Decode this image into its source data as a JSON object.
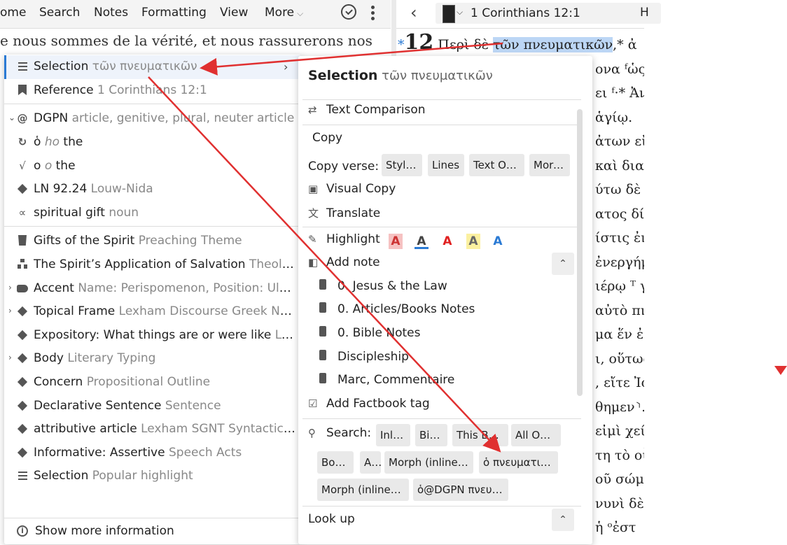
{
  "toolbar": {
    "items": [
      "ome",
      "Search",
      "Notes",
      "Formatting",
      "View",
      "More"
    ]
  },
  "right_pane": {
    "reference": "1 Corinthians 12:1",
    "header_cut": "H",
    "lines": [
      {
        "pre": "",
        "num": "12",
        "text": " Περὶ δὲ ",
        "hl": "τῶν πνευματικῶν",
        "post": ",* ἀ"
      },
      {
        "text": "ονα ᶠὡς ε"
      },
      {
        "text": "ει ᶠ·* Ἀν"
      },
      {
        "text": "ἁγίῳ."
      },
      {
        "text": "ἀτων εἰσ"
      },
      {
        "text": "καὶ διαι"
      },
      {
        "text": "ύτω δὲ δί"
      },
      {
        "text": "ατος δίδο"
      },
      {
        "text": "ίστις ἐν"
      },
      {
        "text": "ἐνεργήμ"
      },
      {
        "text": "ιέρῳ ᵀ γέ"
      },
      {
        "text": "αὐτὸ πνε"
      },
      {
        "text": "μα ἕν ἐσ"
      },
      {
        "text": "ι, οὕτως"
      },
      {
        "text": ", εἴτε Ἰο"
      },
      {
        "text": "θημεν⸃."
      },
      {
        "text": "εἰμὶ χείρ"
      },
      {
        "text": "τη τὸ οὖ"
      },
      {
        "text": "οῦ σώματ"
      },
      {
        "text": "νυνὶ δὲ ὁ"
      },
      {
        "text": "ἡ ᵒἐστ"
      }
    ]
  },
  "background_text": "e nous sommes de la vérité, et nous rassurerons nos",
  "left_menu": {
    "items": [
      {
        "icon": "lines",
        "label": "Selection",
        "sub": " τῶν πνευματικῶν",
        "expand": ""
      },
      {
        "icon": "bookmark",
        "label": "Reference",
        "sub": " 1 Corinthians 12:1",
        "expand": ""
      },
      {
        "icon": "at",
        "label": "DGPN",
        "sub": " article, genitive, plural, neuter article",
        "expand": "⌄"
      },
      {
        "icon": "circle",
        "label": "ὁ ",
        "sub_it": "ho",
        "label2": " the",
        "expand": ""
      },
      {
        "icon": "root",
        "label": "ο ",
        "sub_it": "o",
        "label2": " the",
        "expand": ""
      },
      {
        "icon": "diamond",
        "label": "LN 92.24",
        "sub": " Louw-Nida",
        "expand": ""
      },
      {
        "icon": "alpha",
        "label": "spiritual gift",
        "sub": " noun",
        "expand": ""
      },
      {
        "icon": "trash",
        "label": "Gifts of the Spirit",
        "sub": " Preaching Theme",
        "expand": ""
      },
      {
        "icon": "org",
        "label": "The Spirit’s Application of Salvation",
        "sub": " Theolo…",
        "expand": ""
      },
      {
        "icon": "tag",
        "label": "Accent",
        "sub": " Name: Perispomenon, Position: Ulti…",
        "expand": "›"
      },
      {
        "icon": "diamond",
        "label": "Topical Frame",
        "sub": " Lexham Discourse Greek New…",
        "expand": "›"
      },
      {
        "icon": "diamond",
        "label": "Expository: What things are or were like",
        "sub": " Lon…",
        "expand": ""
      },
      {
        "icon": "diamond",
        "label": "Body",
        "sub": " Literary Typing",
        "expand": "›"
      },
      {
        "icon": "diamond",
        "label": "Concern",
        "sub": " Propositional Outline",
        "expand": ""
      },
      {
        "icon": "diamond",
        "label": "Declarative Sentence",
        "sub": " Sentence",
        "expand": ""
      },
      {
        "icon": "diamond",
        "label": "attributive article",
        "sub": " Lexham SGNT Syntactic F…",
        "expand": ""
      },
      {
        "icon": "diamond",
        "label": "Informative: Assertive",
        "sub": " Speech Acts",
        "expand": ""
      },
      {
        "icon": "lines",
        "label": "Selection",
        "sub": " Popular highlight",
        "expand": ""
      }
    ],
    "show_more": "Show more information"
  },
  "sub_menu": {
    "title": "Selection",
    "title_sub": " τῶν πνευματικῶν",
    "text_comparison": "Text Comparison",
    "copy": "Copy",
    "copy_verse": "Copy verse:",
    "copy_chips": [
      "Styled",
      "Lines",
      "Text Only",
      "More »"
    ],
    "visual_copy": "Visual Copy",
    "translate": "Translate",
    "highlight": "Highlight",
    "highlight_swatches": [
      "A",
      "A",
      "A",
      "A",
      "A"
    ],
    "add_note": "Add note",
    "notebooks": [
      "0. Jesus & the Law",
      "0. Articles/Books Notes",
      "0. Bible Notes",
      "Discipleship",
      "Marc, Commentaire"
    ],
    "factbook": "Add Factbook tag",
    "search": "Search:",
    "search_chips": [
      "Inline",
      "Bible",
      "This Book",
      "All Open",
      "Books",
      "All",
      "Morph (inline):…",
      "ὁ πνευματικός",
      "Morph (inline):…",
      "ὁ@DGPN πνευμ…"
    ],
    "look_up": "Look up"
  },
  "colors": {
    "accent": "#2a7ad4",
    "arrow": "#e03030",
    "highlight_bg": "#bcd6f5"
  }
}
